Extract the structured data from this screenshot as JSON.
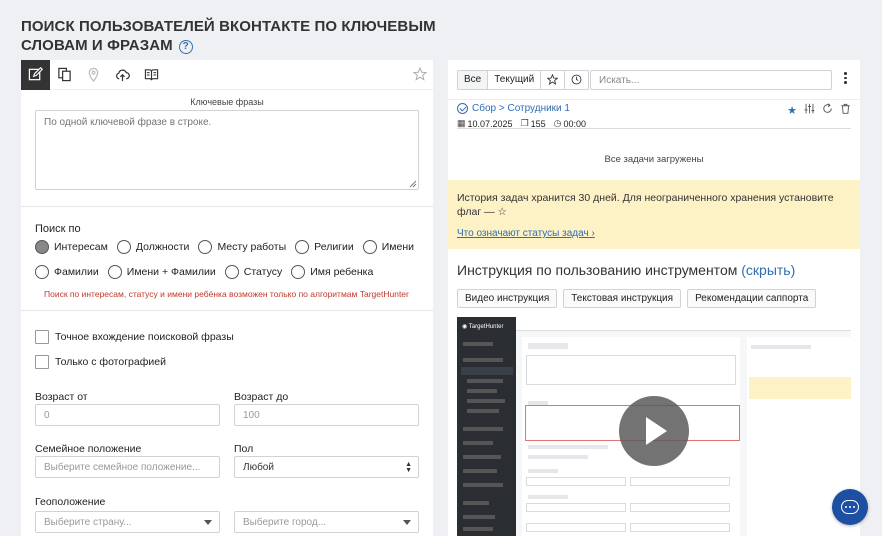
{
  "page": {
    "title": "Поиск пользователей ВКонтакте по ключевым словам и фразам",
    "help_glyph": "?"
  },
  "left": {
    "keywords_label": "Ключевые фразы",
    "keywords_placeholder": "По одной ключевой фразе в строке.",
    "search_by_title": "Поиск по",
    "search_by_options": [
      {
        "label": "Интересам",
        "checked": true
      },
      {
        "label": "Должности",
        "checked": false
      },
      {
        "label": "Месту работы",
        "checked": false
      },
      {
        "label": "Религии",
        "checked": false
      },
      {
        "label": "Имени",
        "checked": false
      },
      {
        "label": "Фамилии",
        "checked": false
      },
      {
        "label": "Имени + Фамилии",
        "checked": false
      },
      {
        "label": "Статусу",
        "checked": false
      },
      {
        "label": "Имя ребенка",
        "checked": false
      }
    ],
    "search_warning": "Поиск по интересам, статусу и имени ребёнка возможен только по алгоритмам TargetHunter",
    "exact_match_label": "Точное вхождение поисковой фразы",
    "with_photo_label": "Только с фотографией",
    "age_from_label": "Возраст от",
    "age_from_value": "0",
    "age_to_label": "Возраст до",
    "age_to_value": "100",
    "marital_label": "Семейное положение",
    "marital_placeholder": "Выберите семейное положение...",
    "gender_label": "Пол",
    "gender_value": "Любой",
    "geo_label": "Геоположение",
    "country_placeholder": "Выберите страну...",
    "city_placeholder": "Выберите город..."
  },
  "right": {
    "filter_all": "Все",
    "filter_current": "Текущий",
    "search_placeholder": "Искать...",
    "task": {
      "title": "Сбор > Сотрудники 1",
      "date": "10.07.2025",
      "count": "155",
      "duration": "00:00"
    },
    "all_loaded": "Все задачи загружены",
    "notice_text": "История задач хранится 30 дней. Для неограниченного хранения установите флаг — ☆",
    "notice_link": "Что означают статусы задач",
    "instructions_title": "Инструкция по пользованию инструментом",
    "instructions_hide": "(скрыть)",
    "buttons": [
      "Видео инструкция",
      "Текстовая инструкция",
      "Рекомендации саппорта"
    ]
  },
  "colors": {
    "accent": "#2f6db5",
    "warning": "#c0392b",
    "notice_bg": "#fdf1c6",
    "chat_fab": "#1d4fa3",
    "active_tool": "#333333"
  },
  "icons": {
    "toolbar": [
      "edit-icon",
      "copy-icon",
      "location-pin-icon",
      "cloud-upload-icon",
      "book-icon"
    ],
    "favorite": "star-outline-icon",
    "history": "clock-icon",
    "task_actions": [
      "star-filled-icon",
      "sliders-icon",
      "refresh-icon",
      "trash-icon"
    ]
  }
}
